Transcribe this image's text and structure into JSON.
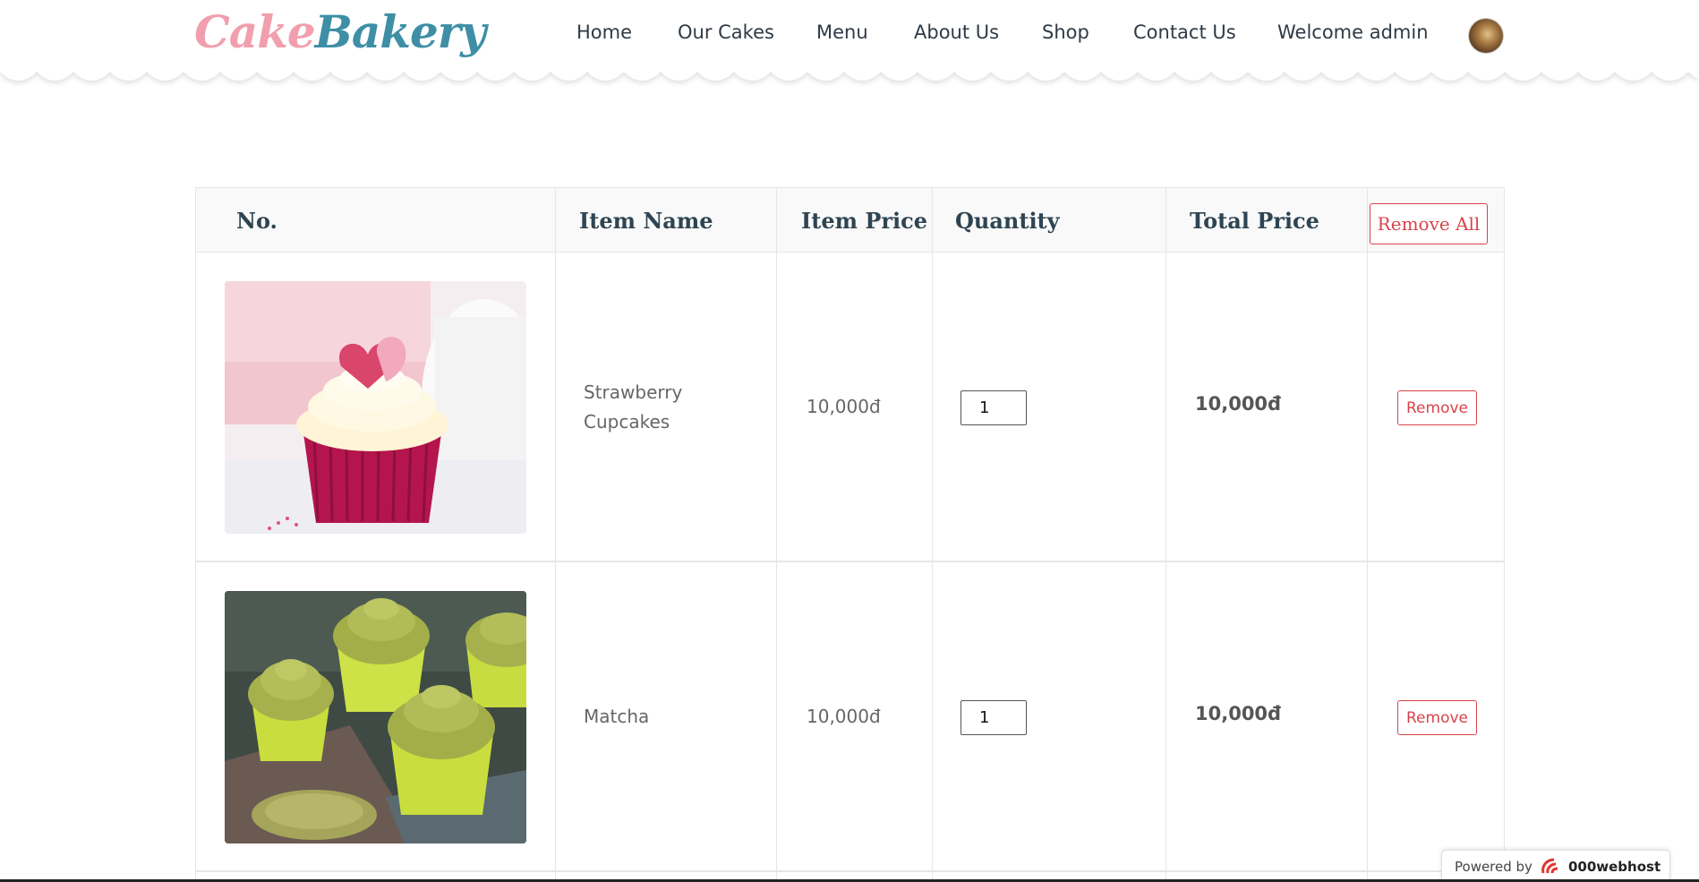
{
  "header": {
    "logo_part1": "Cake",
    "logo_part2": "Bakery",
    "nav": {
      "home": "Home",
      "our_cakes": "Our Cakes",
      "menu": "Menu",
      "about": "About Us",
      "shop": "Shop",
      "contact": "Contact Us",
      "welcome": "Welcome admin"
    }
  },
  "table": {
    "headers": {
      "no": "No.",
      "item_name": "Item Name",
      "item_price": "Item Price",
      "quantity": "Quantity",
      "total_price": "Total Price"
    },
    "remove_all_label": "Remove All",
    "remove_label": "Remove",
    "rows": [
      {
        "name_line1": "Strawberry",
        "name_line2": "Cupcakes",
        "price": "10,000đ",
        "quantity": "1",
        "total": "10,000đ"
      },
      {
        "name_line1": "Matcha",
        "price": "10,000đ",
        "quantity": "1",
        "total": "10,000đ"
      }
    ]
  },
  "footer": {
    "powered_by": "Powered by",
    "host_name": "000webhost"
  },
  "colors": {
    "logo_pink": "#f19fae",
    "logo_teal": "#3e8fa6",
    "accent_red": "#d9434b",
    "heading": "#2e4452"
  }
}
